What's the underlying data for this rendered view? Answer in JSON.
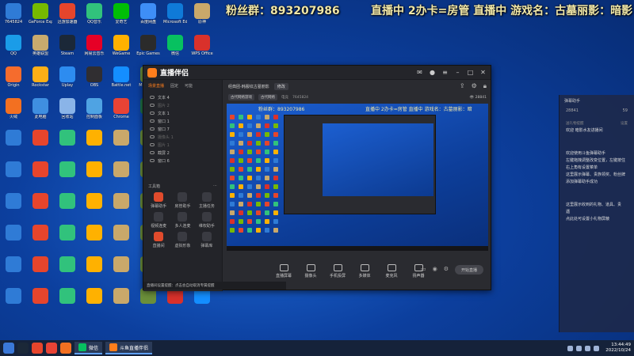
{
  "overlay": {
    "fans_group": "粉丝群：893207986",
    "live_status": "直播中 2办卡=房管 直播中 游戏名：古墓丽影：暗影"
  },
  "desktop_icons": [
    {
      "label": "7645824",
      "color": "#2f7bd6"
    },
    {
      "label": "GeForce Experience",
      "color": "#76b900"
    },
    {
      "label": "迅游加速器",
      "color": "#e6452c"
    },
    {
      "label": "QQ音乐",
      "color": "#31c27c"
    },
    {
      "label": "爱奇艺",
      "color": "#00be06"
    },
    {
      "label": "百度网盘",
      "color": "#3e8ef7"
    },
    {
      "label": "Microsoft Edge",
      "color": "#0f7ad8"
    },
    {
      "label": "原神",
      "color": "#c9a86a"
    },
    {
      "label": "QQ",
      "color": "#1a9ce8"
    },
    {
      "label": "英雄联盟",
      "color": "#c8aa6e"
    },
    {
      "label": "Steam",
      "color": "#1b2838"
    },
    {
      "label": "网易云音乐",
      "color": "#e60026"
    },
    {
      "label": "WeGame",
      "color": "#ffb100"
    },
    {
      "label": "Epic Games",
      "color": "#2b2b2b"
    },
    {
      "label": "微信",
      "color": "#07c160"
    },
    {
      "label": "WPS Office",
      "color": "#d9312b"
    },
    {
      "label": "Origin",
      "color": "#f56c2d"
    },
    {
      "label": "Rockstar",
      "color": "#fcaf17"
    },
    {
      "label": "Uplay",
      "color": "#2d8cf0"
    },
    {
      "label": "OBS",
      "color": "#302e31"
    },
    {
      "label": "Battle.net",
      "color": "#148eff"
    },
    {
      "label": "Minecraft",
      "color": "#6b8f3a"
    },
    {
      "label": "GTA5",
      "color": "#74a03c"
    },
    {
      "label": "PUBG",
      "color": "#f2a900"
    },
    {
      "label": "火绒",
      "color": "#f37021"
    },
    {
      "label": "此电脑",
      "color": "#3f8fe0"
    },
    {
      "label": "回收站",
      "color": "#8ab4e8"
    },
    {
      "label": "控制面板",
      "color": "#4fa3e3"
    },
    {
      "label": "Chrome",
      "color": "#e84335"
    },
    {
      "label": "Excel",
      "color": "#1f7245"
    }
  ],
  "app": {
    "title": "直播伴侣",
    "left_tabs": [
      "场景直播",
      "固定",
      "可能"
    ],
    "scenes": [
      {
        "label": "文本 4",
        "dim": false
      },
      {
        "label": "图片 2",
        "dim": true
      },
      {
        "label": "文本 1",
        "dim": false
      },
      {
        "label": "窗口 1",
        "dim": false
      },
      {
        "label": "窗口 7",
        "dim": false
      },
      {
        "label": "摄像头 1",
        "dim": true
      },
      {
        "label": "图片 1",
        "dim": true
      },
      {
        "label": "截屏 2",
        "dim": false
      },
      {
        "label": "窗口 6",
        "dim": false
      }
    ],
    "tools_title": "工具箱",
    "tools": [
      {
        "label": "弹幕助手",
        "red": true
      },
      {
        "label": "房管助手",
        "red": false
      },
      {
        "label": "主播任务",
        "red": false
      },
      {
        "label": "视频连麦",
        "red": false
      },
      {
        "label": "多人连麦",
        "red": false
      },
      {
        "label": "维权助手",
        "red": false
      },
      {
        "label": "直播间",
        "red": true
      },
      {
        "label": "虚拟形象",
        "red": false
      },
      {
        "label": "弹幕库",
        "red": false
      }
    ],
    "notice": "直播间设置提醒：点击会自动取消专属提醒",
    "main_header_title": "经典团-韩服纹古墓丽影",
    "main_header_badge": "修改",
    "sub_pill_1": "古代网络游戏",
    "sub_pill_2": "古代网络",
    "sub_text": "电竞",
    "room_id": "7645824",
    "viewers": "28841",
    "preview_fans": "粉丝群：893207986",
    "preview_live": "直播中 2办卡=房管 直播中 游戏名：古墓丽影：暗",
    "controls": [
      "直播屏幕",
      "摄像头",
      "手机投屏",
      "多媒体",
      "麦克风",
      "扬声器"
    ],
    "start_live_label": "开始直播"
  },
  "chat": {
    "title": "弹幕助手",
    "stat_left": "28841",
    "stat_right": "59",
    "tab_1": "送礼物提醒",
    "tab_2": "设置",
    "messages": [
      "欢迎 暗影水友进播间",
      "欢迎使用斗鱼弹幕助手",
      "左键拖拽调整改变位置，左键按住",
      "右上角有设置菜单",
      "这里展示弹幕、贵族领奖、粉丝牌",
      "添加弹幕助手成功",
      "这里展示收到的礼物、道具、贵",
      "遇",
      "点此处可设置小礼物屏蔽"
    ]
  },
  "taskbar": {
    "app_1": "微信",
    "app_2": "斗鱼直播伴侣",
    "time": "13:44:49",
    "date": "2022/10/24"
  }
}
